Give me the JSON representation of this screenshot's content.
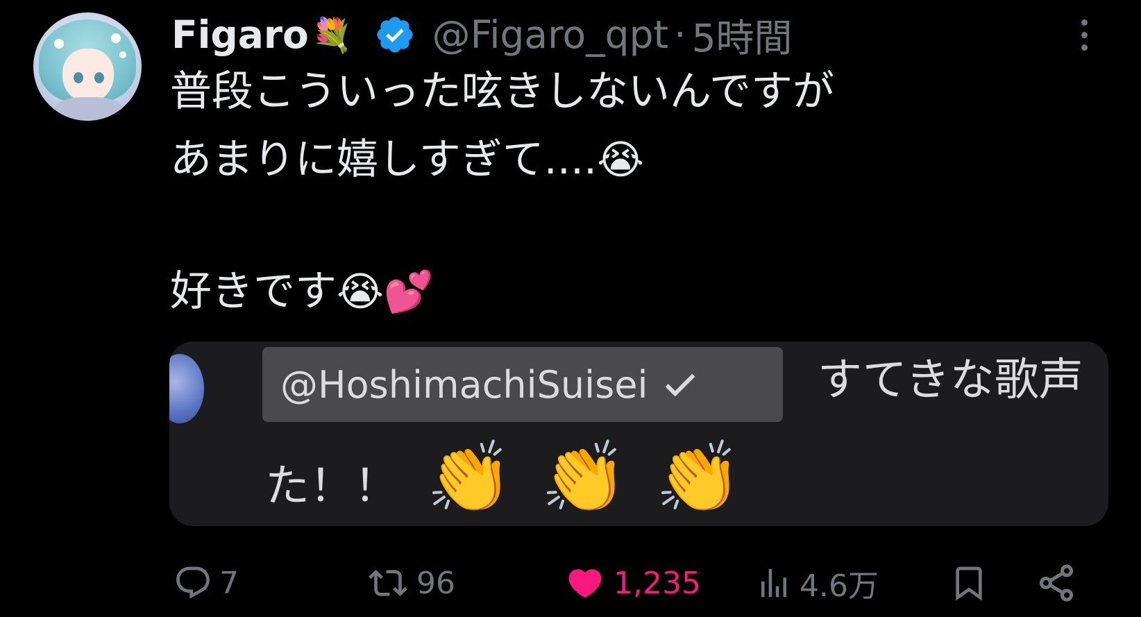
{
  "tweet": {
    "author": {
      "name": "Figaro",
      "name_emoji": "💐",
      "verified": true,
      "handle": "@Figaro_qpt",
      "separator": "·",
      "time": "5時間"
    },
    "text": {
      "line1": "普段こういった呟きしないんですが",
      "line2": "あまりに嬉しすぎて....",
      "line2_emoji": "😭",
      "line3": "好きです",
      "line3_emoji1": "😭",
      "line3_emoji2": "💕"
    },
    "quoted": {
      "mention": "@HoshimachiSuisei",
      "text_line1": "すてきな歌声",
      "text_line2": "た！！",
      "clap_emoji": "👏"
    },
    "stats": {
      "replies": "7",
      "retweets": "96",
      "likes": "1,235",
      "views": "4.6万"
    },
    "icons": {
      "reply": "reply-icon",
      "retweet": "retweet-icon",
      "like": "heart-icon",
      "views": "views-icon",
      "bookmark": "bookmark-icon",
      "share": "share-icon",
      "more": "more-icon",
      "verified": "verified-badge-icon"
    },
    "colors": {
      "background": "#000000",
      "text": "#e7e9ea",
      "secondary": "#71767b",
      "verified": "#1d9bf0",
      "like": "#f91880",
      "quote_bg": "#1c1c1e"
    }
  }
}
